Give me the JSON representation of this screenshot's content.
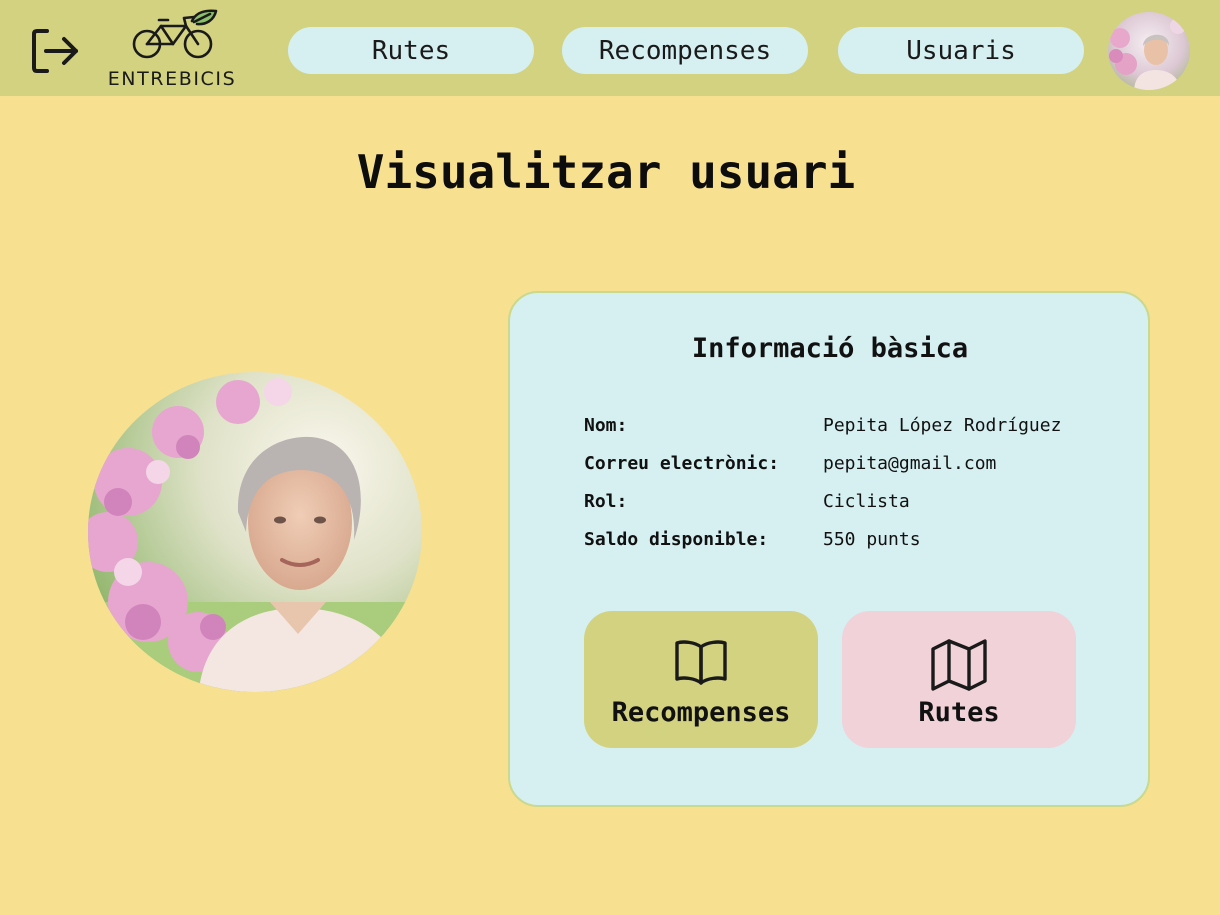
{
  "header": {
    "logo_text": "ENTREBICIS",
    "nav": [
      {
        "label": "Rutes"
      },
      {
        "label": "Recompenses"
      },
      {
        "label": "Usuaris"
      }
    ]
  },
  "page": {
    "title": "Visualitzar usuari"
  },
  "card": {
    "title": "Informació bàsica",
    "fields": [
      {
        "label": "Nom:",
        "value": "Pepita López Rodríguez"
      },
      {
        "label": "Correu electrònic:",
        "value": "pepita@gmail.com"
      },
      {
        "label": "Rol:",
        "value": "Ciclista"
      },
      {
        "label": "Saldo disponible:",
        "value": "550 punts"
      }
    ],
    "actions": [
      {
        "label": "Recompenses",
        "icon": "book-icon",
        "color": "#d2d281"
      },
      {
        "label": "Rutes",
        "icon": "map-icon",
        "color": "#f0d2d8"
      }
    ]
  },
  "colors": {
    "background": "#f7e08f",
    "header": "#d2d281",
    "nav_button": "#d6eff1",
    "card": "#d6eff1"
  },
  "icons": {
    "logout": "logout-icon",
    "logo": "bicycle-leaf-icon"
  }
}
